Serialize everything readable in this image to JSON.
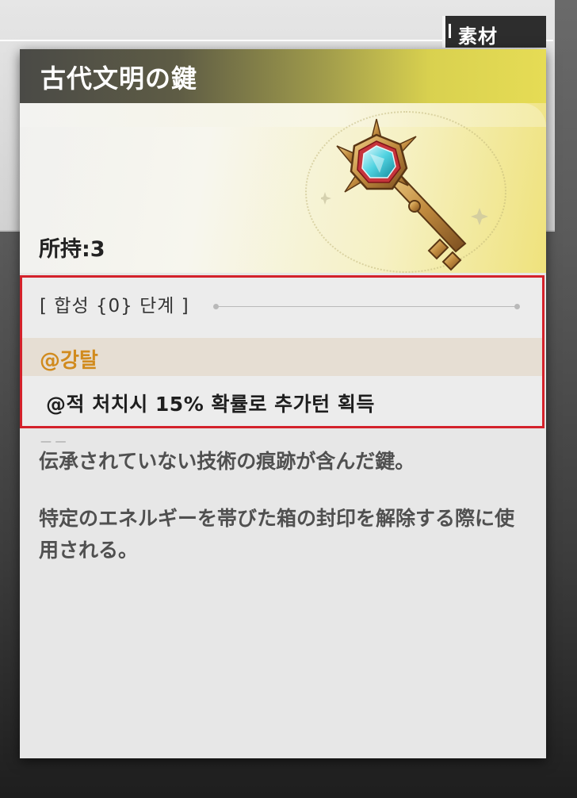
{
  "category_tag": "素材",
  "item": {
    "name": "古代文明の鍵",
    "owned_label": "所持:3"
  },
  "synthesis": {
    "header": "[ 합성 {0} 단계 ]",
    "skill_name": "@강탈",
    "effect": "@적 처치시 15% 확률로 추가턴 획득"
  },
  "description": {
    "separator": "— —",
    "line1": "伝承されていない技術の痕跡が含んだ鍵。",
    "line2": "特定のエネルギーを帯びた箱の封印を解除する際に使用される。"
  },
  "icons": {
    "item_icon": "ancient-key-icon"
  },
  "colors": {
    "highlight_border": "#d4222b",
    "skill_text": "#d18b1e",
    "title_gradient_end": "#e6dc55"
  }
}
